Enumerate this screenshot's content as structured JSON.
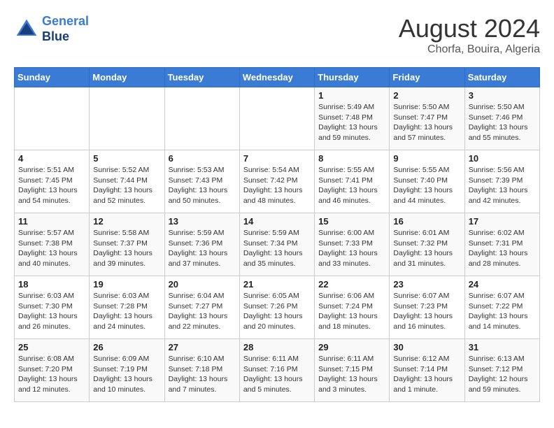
{
  "logo": {
    "line1": "General",
    "line2": "Blue"
  },
  "title": "August 2024",
  "subtitle": "Chorfa, Bouira, Algeria",
  "days_header": [
    "Sunday",
    "Monday",
    "Tuesday",
    "Wednesday",
    "Thursday",
    "Friday",
    "Saturday"
  ],
  "weeks": [
    [
      {
        "day": "",
        "info": ""
      },
      {
        "day": "",
        "info": ""
      },
      {
        "day": "",
        "info": ""
      },
      {
        "day": "",
        "info": ""
      },
      {
        "day": "1",
        "info": "Sunrise: 5:49 AM\nSunset: 7:48 PM\nDaylight: 13 hours\nand 59 minutes."
      },
      {
        "day": "2",
        "info": "Sunrise: 5:50 AM\nSunset: 7:47 PM\nDaylight: 13 hours\nand 57 minutes."
      },
      {
        "day": "3",
        "info": "Sunrise: 5:50 AM\nSunset: 7:46 PM\nDaylight: 13 hours\nand 55 minutes."
      }
    ],
    [
      {
        "day": "4",
        "info": "Sunrise: 5:51 AM\nSunset: 7:45 PM\nDaylight: 13 hours\nand 54 minutes."
      },
      {
        "day": "5",
        "info": "Sunrise: 5:52 AM\nSunset: 7:44 PM\nDaylight: 13 hours\nand 52 minutes."
      },
      {
        "day": "6",
        "info": "Sunrise: 5:53 AM\nSunset: 7:43 PM\nDaylight: 13 hours\nand 50 minutes."
      },
      {
        "day": "7",
        "info": "Sunrise: 5:54 AM\nSunset: 7:42 PM\nDaylight: 13 hours\nand 48 minutes."
      },
      {
        "day": "8",
        "info": "Sunrise: 5:55 AM\nSunset: 7:41 PM\nDaylight: 13 hours\nand 46 minutes."
      },
      {
        "day": "9",
        "info": "Sunrise: 5:55 AM\nSunset: 7:40 PM\nDaylight: 13 hours\nand 44 minutes."
      },
      {
        "day": "10",
        "info": "Sunrise: 5:56 AM\nSunset: 7:39 PM\nDaylight: 13 hours\nand 42 minutes."
      }
    ],
    [
      {
        "day": "11",
        "info": "Sunrise: 5:57 AM\nSunset: 7:38 PM\nDaylight: 13 hours\nand 40 minutes."
      },
      {
        "day": "12",
        "info": "Sunrise: 5:58 AM\nSunset: 7:37 PM\nDaylight: 13 hours\nand 39 minutes."
      },
      {
        "day": "13",
        "info": "Sunrise: 5:59 AM\nSunset: 7:36 PM\nDaylight: 13 hours\nand 37 minutes."
      },
      {
        "day": "14",
        "info": "Sunrise: 5:59 AM\nSunset: 7:34 PM\nDaylight: 13 hours\nand 35 minutes."
      },
      {
        "day": "15",
        "info": "Sunrise: 6:00 AM\nSunset: 7:33 PM\nDaylight: 13 hours\nand 33 minutes."
      },
      {
        "day": "16",
        "info": "Sunrise: 6:01 AM\nSunset: 7:32 PM\nDaylight: 13 hours\nand 31 minutes."
      },
      {
        "day": "17",
        "info": "Sunrise: 6:02 AM\nSunset: 7:31 PM\nDaylight: 13 hours\nand 28 minutes."
      }
    ],
    [
      {
        "day": "18",
        "info": "Sunrise: 6:03 AM\nSunset: 7:30 PM\nDaylight: 13 hours\nand 26 minutes."
      },
      {
        "day": "19",
        "info": "Sunrise: 6:03 AM\nSunset: 7:28 PM\nDaylight: 13 hours\nand 24 minutes."
      },
      {
        "day": "20",
        "info": "Sunrise: 6:04 AM\nSunset: 7:27 PM\nDaylight: 13 hours\nand 22 minutes."
      },
      {
        "day": "21",
        "info": "Sunrise: 6:05 AM\nSunset: 7:26 PM\nDaylight: 13 hours\nand 20 minutes."
      },
      {
        "day": "22",
        "info": "Sunrise: 6:06 AM\nSunset: 7:24 PM\nDaylight: 13 hours\nand 18 minutes."
      },
      {
        "day": "23",
        "info": "Sunrise: 6:07 AM\nSunset: 7:23 PM\nDaylight: 13 hours\nand 16 minutes."
      },
      {
        "day": "24",
        "info": "Sunrise: 6:07 AM\nSunset: 7:22 PM\nDaylight: 13 hours\nand 14 minutes."
      }
    ],
    [
      {
        "day": "25",
        "info": "Sunrise: 6:08 AM\nSunset: 7:20 PM\nDaylight: 13 hours\nand 12 minutes."
      },
      {
        "day": "26",
        "info": "Sunrise: 6:09 AM\nSunset: 7:19 PM\nDaylight: 13 hours\nand 10 minutes."
      },
      {
        "day": "27",
        "info": "Sunrise: 6:10 AM\nSunset: 7:18 PM\nDaylight: 13 hours\nand 7 minutes."
      },
      {
        "day": "28",
        "info": "Sunrise: 6:11 AM\nSunset: 7:16 PM\nDaylight: 13 hours\nand 5 minutes."
      },
      {
        "day": "29",
        "info": "Sunrise: 6:11 AM\nSunset: 7:15 PM\nDaylight: 13 hours\nand 3 minutes."
      },
      {
        "day": "30",
        "info": "Sunrise: 6:12 AM\nSunset: 7:14 PM\nDaylight: 13 hours\nand 1 minute."
      },
      {
        "day": "31",
        "info": "Sunrise: 6:13 AM\nSunset: 7:12 PM\nDaylight: 12 hours\nand 59 minutes."
      }
    ]
  ]
}
